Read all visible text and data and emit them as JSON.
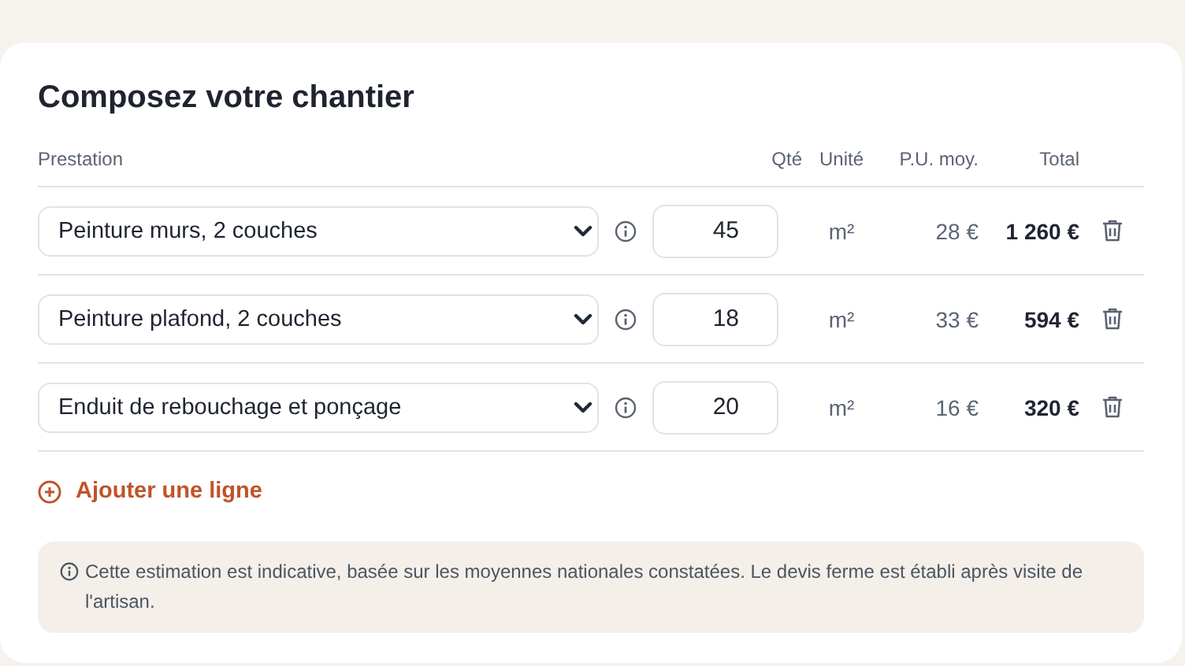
{
  "title": "Composez votre chantier",
  "columns": {
    "service": "Prestation",
    "qty": "Qté",
    "unit": "Unité",
    "unit_price": "P.U. moy.",
    "total": "Total"
  },
  "rows": [
    {
      "service": "Peinture murs, 2 couches",
      "qty": "45",
      "unit": "m²",
      "unit_price": "28 €",
      "total": "1 260 €"
    },
    {
      "service": "Peinture plafond, 2 couches",
      "qty": "18",
      "unit": "m²",
      "unit_price": "33 €",
      "total": "594 €"
    },
    {
      "service": "Enduit de rebouchage et ponçage",
      "qty": "20",
      "unit": "m²",
      "unit_price": "16 €",
      "total": "320 €"
    }
  ],
  "add_line": "Ajouter une ligne",
  "note": "Cette estimation est indicative, basée sur les moyennes nationales constatées. Le devis ferme est établi après visite de l'artisan."
}
